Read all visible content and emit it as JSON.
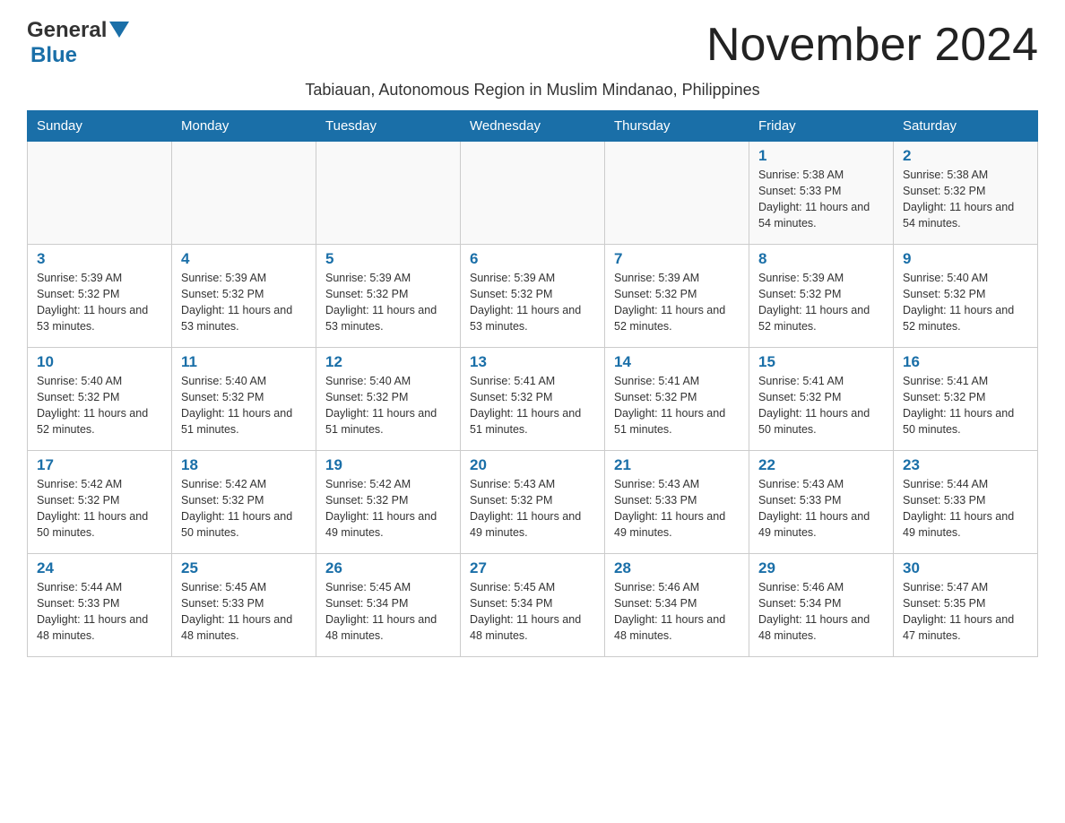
{
  "logo": {
    "general": "General",
    "blue": "Blue"
  },
  "title": "November 2024",
  "subtitle": "Tabiauan, Autonomous Region in Muslim Mindanao, Philippines",
  "headers": [
    "Sunday",
    "Monday",
    "Tuesday",
    "Wednesday",
    "Thursday",
    "Friday",
    "Saturday"
  ],
  "weeks": [
    [
      {
        "day": "",
        "info": ""
      },
      {
        "day": "",
        "info": ""
      },
      {
        "day": "",
        "info": ""
      },
      {
        "day": "",
        "info": ""
      },
      {
        "day": "",
        "info": ""
      },
      {
        "day": "1",
        "info": "Sunrise: 5:38 AM\nSunset: 5:33 PM\nDaylight: 11 hours and 54 minutes."
      },
      {
        "day": "2",
        "info": "Sunrise: 5:38 AM\nSunset: 5:32 PM\nDaylight: 11 hours and 54 minutes."
      }
    ],
    [
      {
        "day": "3",
        "info": "Sunrise: 5:39 AM\nSunset: 5:32 PM\nDaylight: 11 hours and 53 minutes."
      },
      {
        "day": "4",
        "info": "Sunrise: 5:39 AM\nSunset: 5:32 PM\nDaylight: 11 hours and 53 minutes."
      },
      {
        "day": "5",
        "info": "Sunrise: 5:39 AM\nSunset: 5:32 PM\nDaylight: 11 hours and 53 minutes."
      },
      {
        "day": "6",
        "info": "Sunrise: 5:39 AM\nSunset: 5:32 PM\nDaylight: 11 hours and 53 minutes."
      },
      {
        "day": "7",
        "info": "Sunrise: 5:39 AM\nSunset: 5:32 PM\nDaylight: 11 hours and 52 minutes."
      },
      {
        "day": "8",
        "info": "Sunrise: 5:39 AM\nSunset: 5:32 PM\nDaylight: 11 hours and 52 minutes."
      },
      {
        "day": "9",
        "info": "Sunrise: 5:40 AM\nSunset: 5:32 PM\nDaylight: 11 hours and 52 minutes."
      }
    ],
    [
      {
        "day": "10",
        "info": "Sunrise: 5:40 AM\nSunset: 5:32 PM\nDaylight: 11 hours and 52 minutes."
      },
      {
        "day": "11",
        "info": "Sunrise: 5:40 AM\nSunset: 5:32 PM\nDaylight: 11 hours and 51 minutes."
      },
      {
        "day": "12",
        "info": "Sunrise: 5:40 AM\nSunset: 5:32 PM\nDaylight: 11 hours and 51 minutes."
      },
      {
        "day": "13",
        "info": "Sunrise: 5:41 AM\nSunset: 5:32 PM\nDaylight: 11 hours and 51 minutes."
      },
      {
        "day": "14",
        "info": "Sunrise: 5:41 AM\nSunset: 5:32 PM\nDaylight: 11 hours and 51 minutes."
      },
      {
        "day": "15",
        "info": "Sunrise: 5:41 AM\nSunset: 5:32 PM\nDaylight: 11 hours and 50 minutes."
      },
      {
        "day": "16",
        "info": "Sunrise: 5:41 AM\nSunset: 5:32 PM\nDaylight: 11 hours and 50 minutes."
      }
    ],
    [
      {
        "day": "17",
        "info": "Sunrise: 5:42 AM\nSunset: 5:32 PM\nDaylight: 11 hours and 50 minutes."
      },
      {
        "day": "18",
        "info": "Sunrise: 5:42 AM\nSunset: 5:32 PM\nDaylight: 11 hours and 50 minutes."
      },
      {
        "day": "19",
        "info": "Sunrise: 5:42 AM\nSunset: 5:32 PM\nDaylight: 11 hours and 49 minutes."
      },
      {
        "day": "20",
        "info": "Sunrise: 5:43 AM\nSunset: 5:32 PM\nDaylight: 11 hours and 49 minutes."
      },
      {
        "day": "21",
        "info": "Sunrise: 5:43 AM\nSunset: 5:33 PM\nDaylight: 11 hours and 49 minutes."
      },
      {
        "day": "22",
        "info": "Sunrise: 5:43 AM\nSunset: 5:33 PM\nDaylight: 11 hours and 49 minutes."
      },
      {
        "day": "23",
        "info": "Sunrise: 5:44 AM\nSunset: 5:33 PM\nDaylight: 11 hours and 49 minutes."
      }
    ],
    [
      {
        "day": "24",
        "info": "Sunrise: 5:44 AM\nSunset: 5:33 PM\nDaylight: 11 hours and 48 minutes."
      },
      {
        "day": "25",
        "info": "Sunrise: 5:45 AM\nSunset: 5:33 PM\nDaylight: 11 hours and 48 minutes."
      },
      {
        "day": "26",
        "info": "Sunrise: 5:45 AM\nSunset: 5:34 PM\nDaylight: 11 hours and 48 minutes."
      },
      {
        "day": "27",
        "info": "Sunrise: 5:45 AM\nSunset: 5:34 PM\nDaylight: 11 hours and 48 minutes."
      },
      {
        "day": "28",
        "info": "Sunrise: 5:46 AM\nSunset: 5:34 PM\nDaylight: 11 hours and 48 minutes."
      },
      {
        "day": "29",
        "info": "Sunrise: 5:46 AM\nSunset: 5:34 PM\nDaylight: 11 hours and 48 minutes."
      },
      {
        "day": "30",
        "info": "Sunrise: 5:47 AM\nSunset: 5:35 PM\nDaylight: 11 hours and 47 minutes."
      }
    ]
  ]
}
